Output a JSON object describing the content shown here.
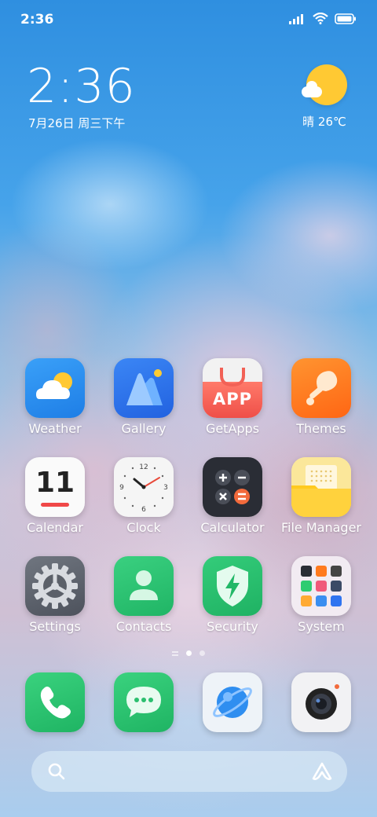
{
  "status_bar": {
    "time": "2:36",
    "signal_icon": "signal-bars-icon",
    "wifi_icon": "wifi-icon",
    "battery_icon": "battery-icon"
  },
  "clock_widget": {
    "time": "2:36",
    "date": "7月26日 周三下午"
  },
  "weather_widget": {
    "icon": "sun-cloud-icon",
    "text": "晴 26℃"
  },
  "apps": [
    {
      "label": "Weather",
      "icon": "weather-icon"
    },
    {
      "label": "Gallery",
      "icon": "gallery-icon"
    },
    {
      "label": "GetApps",
      "icon": "getapps-icon",
      "icon_text": "APP"
    },
    {
      "label": "Themes",
      "icon": "themes-icon"
    },
    {
      "label": "Calendar",
      "icon": "calendar-icon",
      "icon_text": "11"
    },
    {
      "label": "Clock",
      "icon": "clock-icon"
    },
    {
      "label": "Calculator",
      "icon": "calculator-icon"
    },
    {
      "label": "File Manager",
      "icon": "folder-icon"
    },
    {
      "label": "Settings",
      "icon": "gear-icon"
    },
    {
      "label": "Contacts",
      "icon": "contacts-icon"
    },
    {
      "label": "Security",
      "icon": "shield-icon"
    },
    {
      "label": "System",
      "icon": "system-folder-icon"
    }
  ],
  "page_indicator": {
    "pages": 2,
    "current": 1
  },
  "dock": [
    {
      "icon": "phone-icon"
    },
    {
      "icon": "messages-icon"
    },
    {
      "icon": "browser-icon"
    },
    {
      "icon": "camera-icon"
    }
  ],
  "search_bar": {
    "search_icon": "search-icon",
    "assistant_icon": "assistant-icon"
  },
  "colors": {
    "weather_bg": "#2f8ef0",
    "gallery_bg": "#2f74f0",
    "getapps_bg": "#f05a50",
    "themes_bg": "#ff7a1e",
    "green": "#2ecc71",
    "calc_bg": "#2a2d35",
    "folder": "#ffcc22"
  }
}
